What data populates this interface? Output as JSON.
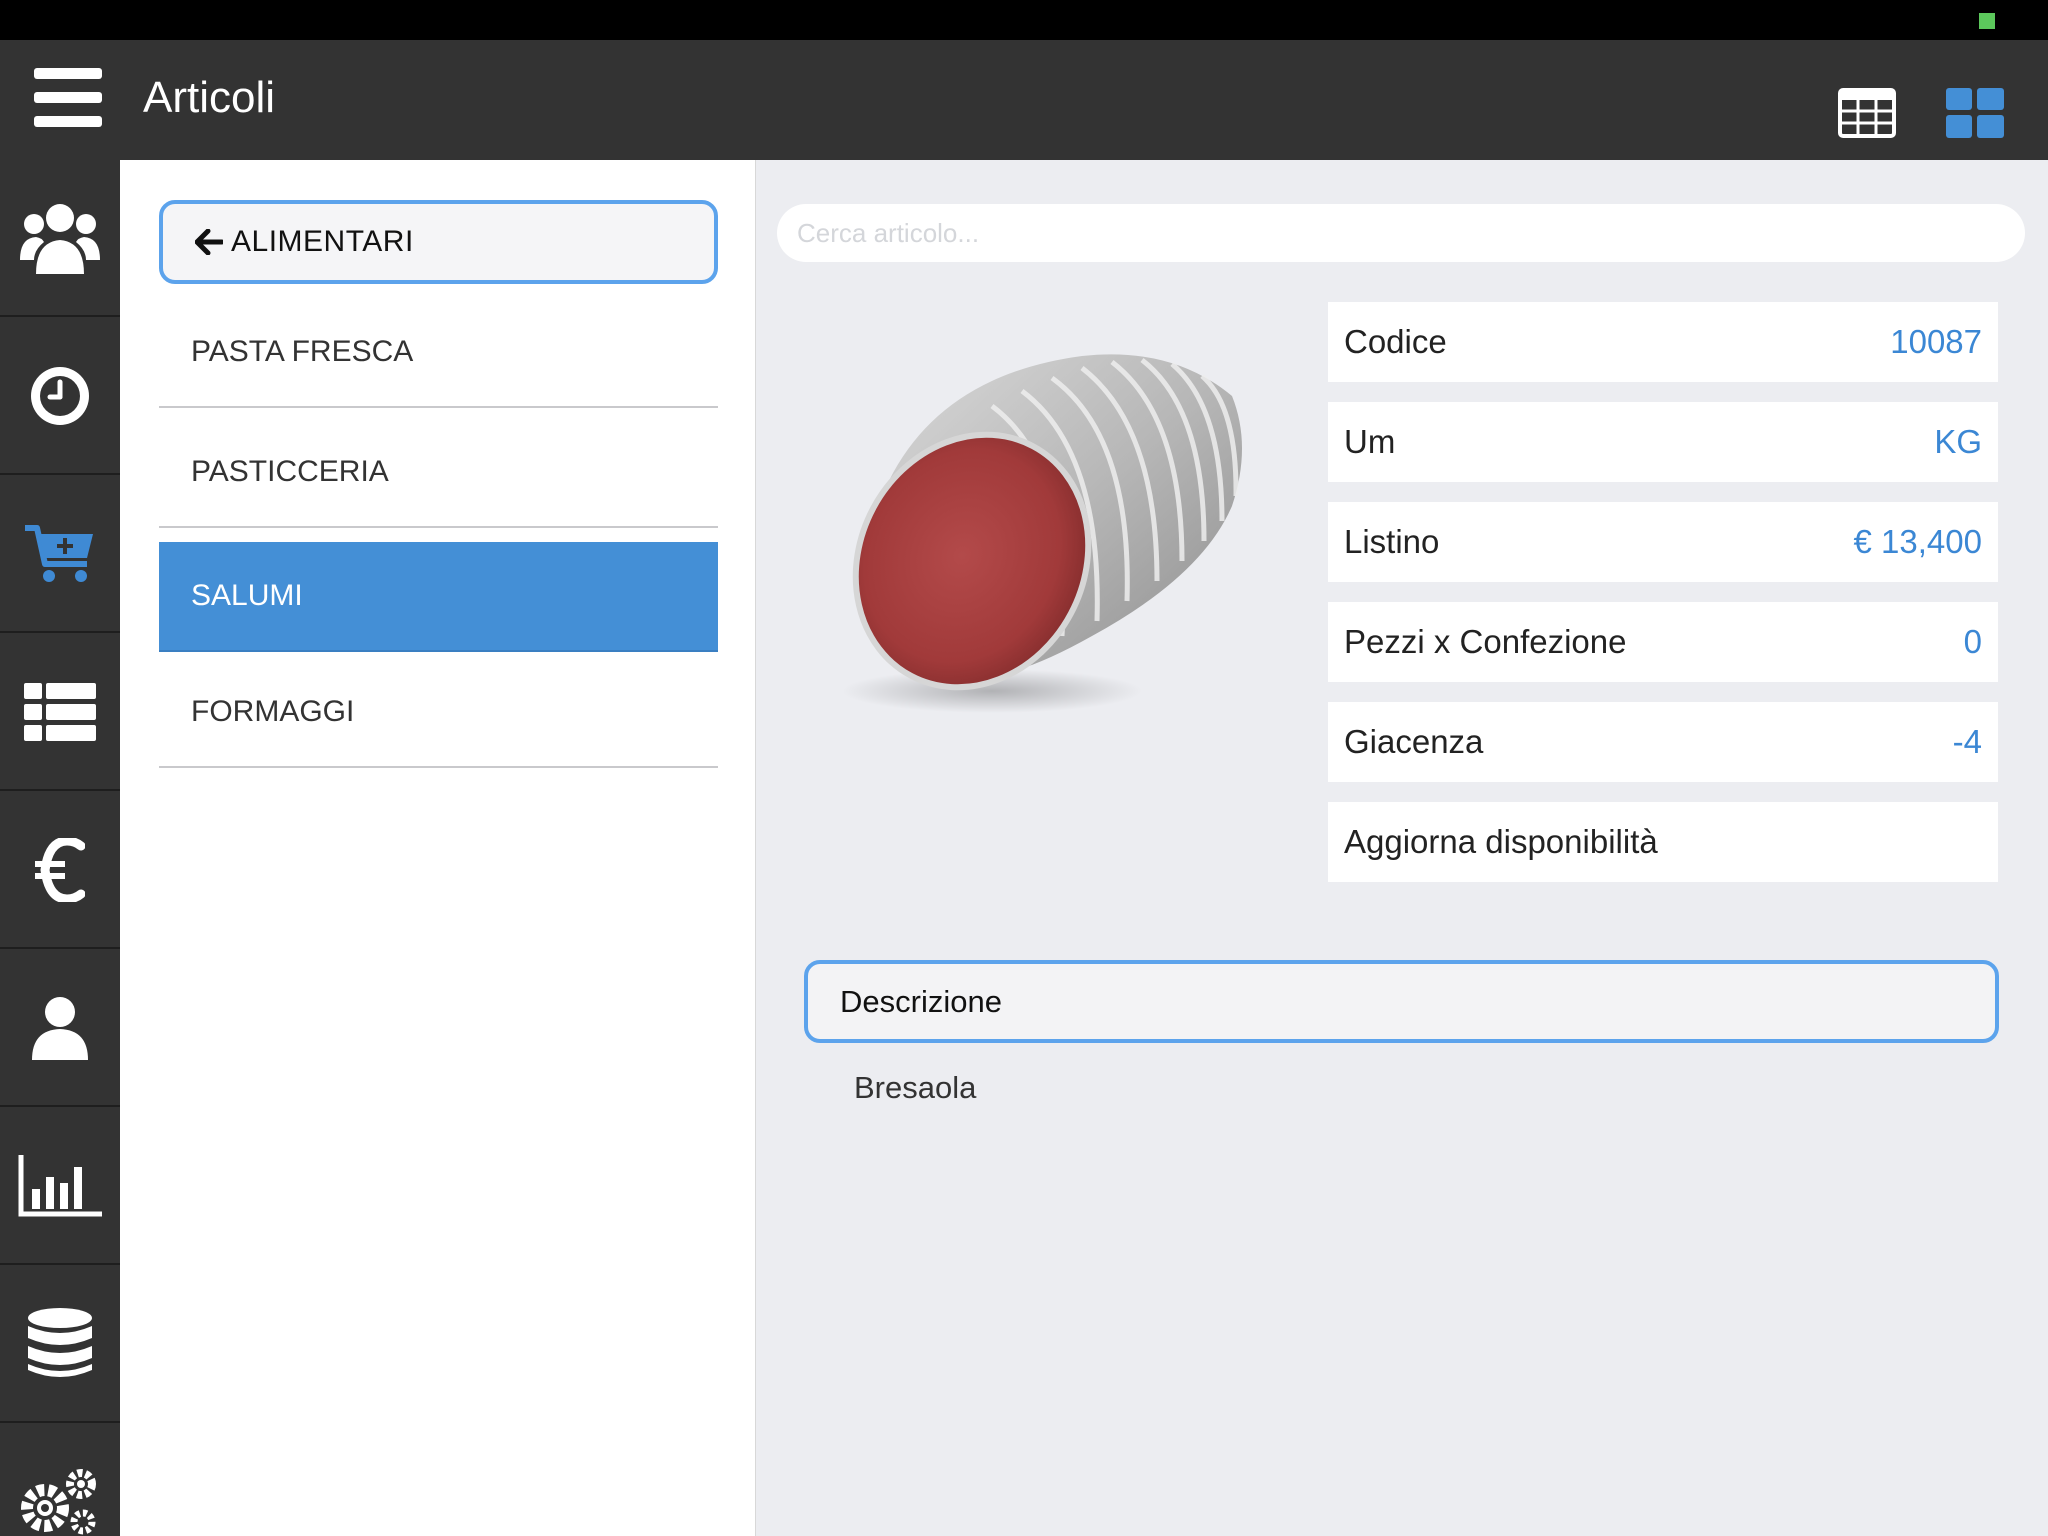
{
  "header": {
    "title": "Articoli"
  },
  "sidebar": {
    "items": [
      {
        "icon": "users-icon"
      },
      {
        "icon": "clock-icon"
      },
      {
        "icon": "cart-add-icon",
        "color": "#3f8ad4"
      },
      {
        "icon": "list-icon"
      },
      {
        "icon": "euro-icon"
      },
      {
        "icon": "user-icon"
      },
      {
        "icon": "bar-chart-icon"
      },
      {
        "icon": "database-icon"
      },
      {
        "icon": "gears-icon"
      }
    ]
  },
  "categories": {
    "back_label": "ALIMENTARI",
    "items": [
      {
        "label": "PASTA FRESCA",
        "selected": false
      },
      {
        "label": "PASTICCERIA",
        "selected": false
      },
      {
        "label": "SALUMI",
        "selected": true
      },
      {
        "label": "FORMAGGI",
        "selected": false
      }
    ]
  },
  "search": {
    "placeholder": "Cerca articolo...",
    "value": ""
  },
  "product": {
    "properties": [
      {
        "label": "Codice",
        "value": "10087"
      },
      {
        "label": "Um",
        "value": "KG"
      },
      {
        "label": "Listino",
        "value": "€ 13,400"
      },
      {
        "label": "Pezzi x Confezione",
        "value": "0"
      },
      {
        "label": "Giacenza",
        "value": "-4"
      },
      {
        "label": "Aggiorna disponibilità",
        "value": ""
      }
    ],
    "description_label": "Descrizione",
    "description": "Bresaola"
  },
  "colors": {
    "accent": "#448fd6",
    "value_text": "#3b87d4",
    "header_bg": "#333333",
    "main_bg": "#ecedf1"
  }
}
